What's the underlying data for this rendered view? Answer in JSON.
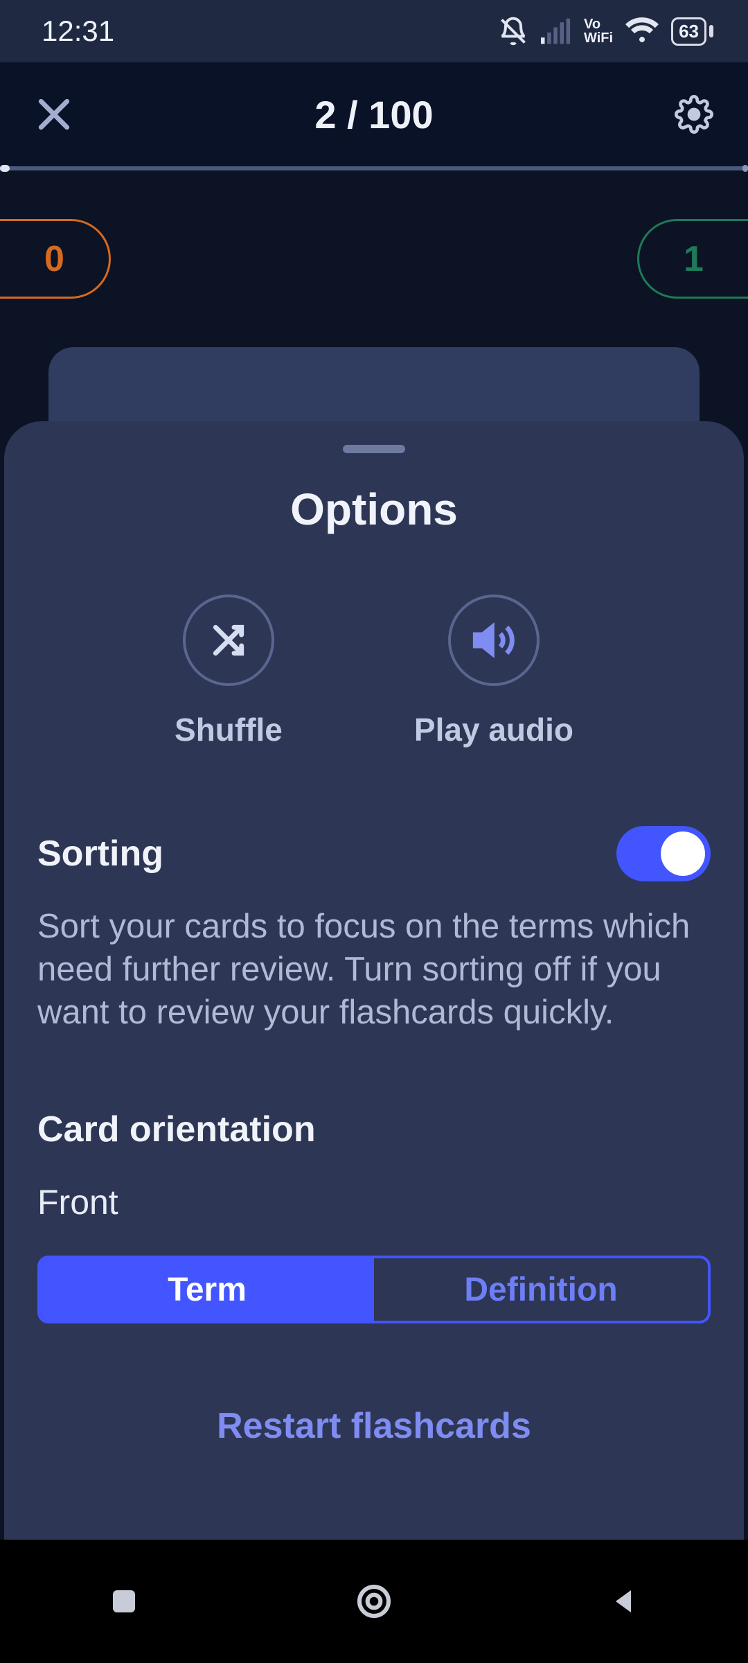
{
  "status": {
    "time": "12:31",
    "battery": "63"
  },
  "header": {
    "progress_label": "2 / 100"
  },
  "scores": {
    "left": "0",
    "right": "1"
  },
  "sheet": {
    "title": "Options",
    "shuffle_label": "Shuffle",
    "play_audio_label": "Play audio",
    "sorting": {
      "heading": "Sorting",
      "description": "Sort your cards to focus on the terms which need further review. Turn sorting off if you want to review your flashcards quickly.",
      "enabled": true
    },
    "card_orientation": {
      "heading": "Card orientation",
      "front_label": "Front",
      "term_label": "Term",
      "definition_label": "Definition",
      "selected": "term"
    },
    "restart_label": "Restart flashcards"
  }
}
